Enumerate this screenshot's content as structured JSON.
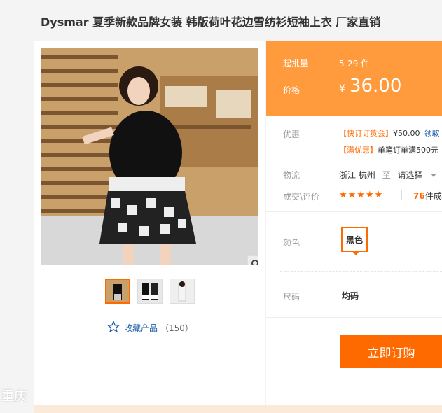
{
  "product": {
    "title": "Dysmar 夏季新款品牌女装 韩版荷叶花边雪纺衫短袖上衣 厂家直销"
  },
  "gallery": {
    "favorite_label": "收藏产品",
    "favorite_count": "（150）"
  },
  "pricing": {
    "moq_label": "起批量",
    "moq_value": "5-29 件",
    "price_label": "价格",
    "currency": "¥",
    "price": "36.00"
  },
  "promotions": {
    "label": "优惠",
    "items": [
      {
        "tag": "【快订订货会】",
        "text": "¥50.00",
        "link": "领取"
      },
      {
        "tag": "【满优惠】",
        "text": "单笔订单满500元"
      }
    ]
  },
  "shipping": {
    "label": "物流",
    "province": "浙江",
    "city": "杭州",
    "to": "至",
    "select": "请选择"
  },
  "trade": {
    "label": "成交\\评价",
    "stars": "★★★★★",
    "count": "76",
    "unit": "件成"
  },
  "options": {
    "color_label": "颜色",
    "color_value": "黑色",
    "size_label": "尺码",
    "size_value": "均码"
  },
  "actions": {
    "buy_label": "立即订购"
  },
  "watermark": "重庆",
  "colors": {
    "accent": "#ff6a00",
    "price_bg": "#ff9a3d",
    "link": "#1e5fa8"
  }
}
